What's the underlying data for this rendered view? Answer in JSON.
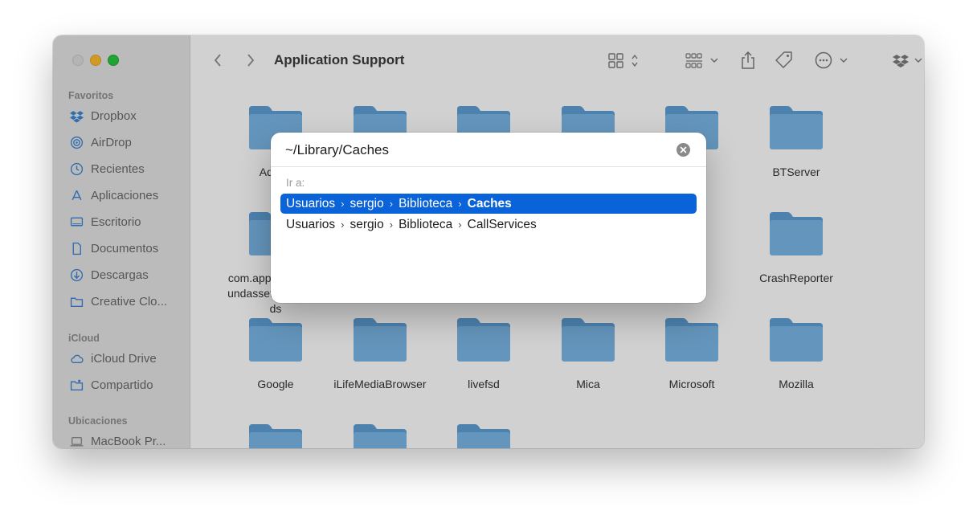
{
  "window": {
    "title": "Application Support"
  },
  "sidebar": {
    "sections": [
      {
        "title": "Favoritos",
        "items": [
          {
            "label": "Dropbox",
            "icon": "dropbox-icon"
          },
          {
            "label": "AirDrop",
            "icon": "airdrop-icon"
          },
          {
            "label": "Recientes",
            "icon": "clock-icon"
          },
          {
            "label": "Aplicaciones",
            "icon": "applications-icon"
          },
          {
            "label": "Escritorio",
            "icon": "desktop-icon"
          },
          {
            "label": "Documentos",
            "icon": "document-icon"
          },
          {
            "label": "Descargas",
            "icon": "download-icon"
          },
          {
            "label": "Creative Clo...",
            "icon": "folder-icon"
          }
        ]
      },
      {
        "title": "iCloud",
        "items": [
          {
            "label": "iCloud Drive",
            "icon": "cloud-icon"
          },
          {
            "label": "Compartido",
            "icon": "shared-folder-icon"
          }
        ]
      },
      {
        "title": "Ubicaciones",
        "items": [
          {
            "label": "MacBook Pr...",
            "icon": "laptop-icon"
          }
        ]
      }
    ]
  },
  "folders": [
    {
      "label": "Adobe"
    },
    {
      "label": ""
    },
    {
      "label": ""
    },
    {
      "label": ""
    },
    {
      "label": ""
    },
    {
      "label": "BTServer"
    },
    {
      "label": "com.apple.backgroundassets.downloads"
    },
    {
      "label": "CrashReporter"
    },
    {
      "label": "Google"
    },
    {
      "label": "iLifeMediaBrowser"
    },
    {
      "label": "livefsd"
    },
    {
      "label": "Mica"
    },
    {
      "label": "Microsoft"
    },
    {
      "label": "Mozilla"
    },
    {
      "label": ""
    },
    {
      "label": ""
    },
    {
      "label": ""
    }
  ],
  "goto_dialog": {
    "path_value": "~/Library/Caches",
    "goto_label": "Ir a:",
    "suggestions": [
      {
        "crumbs": [
          "Usuarios",
          "sergio",
          "Biblioteca"
        ],
        "last": "Caches",
        "selected": true
      },
      {
        "crumbs": [
          "Usuarios",
          "sergio",
          "Biblioteca"
        ],
        "last": "CallServices",
        "selected": false
      }
    ]
  },
  "colors": {
    "accent": "#0a63d8",
    "folder": "#7ab6e6",
    "folder_tab": "#5f9fd6"
  }
}
